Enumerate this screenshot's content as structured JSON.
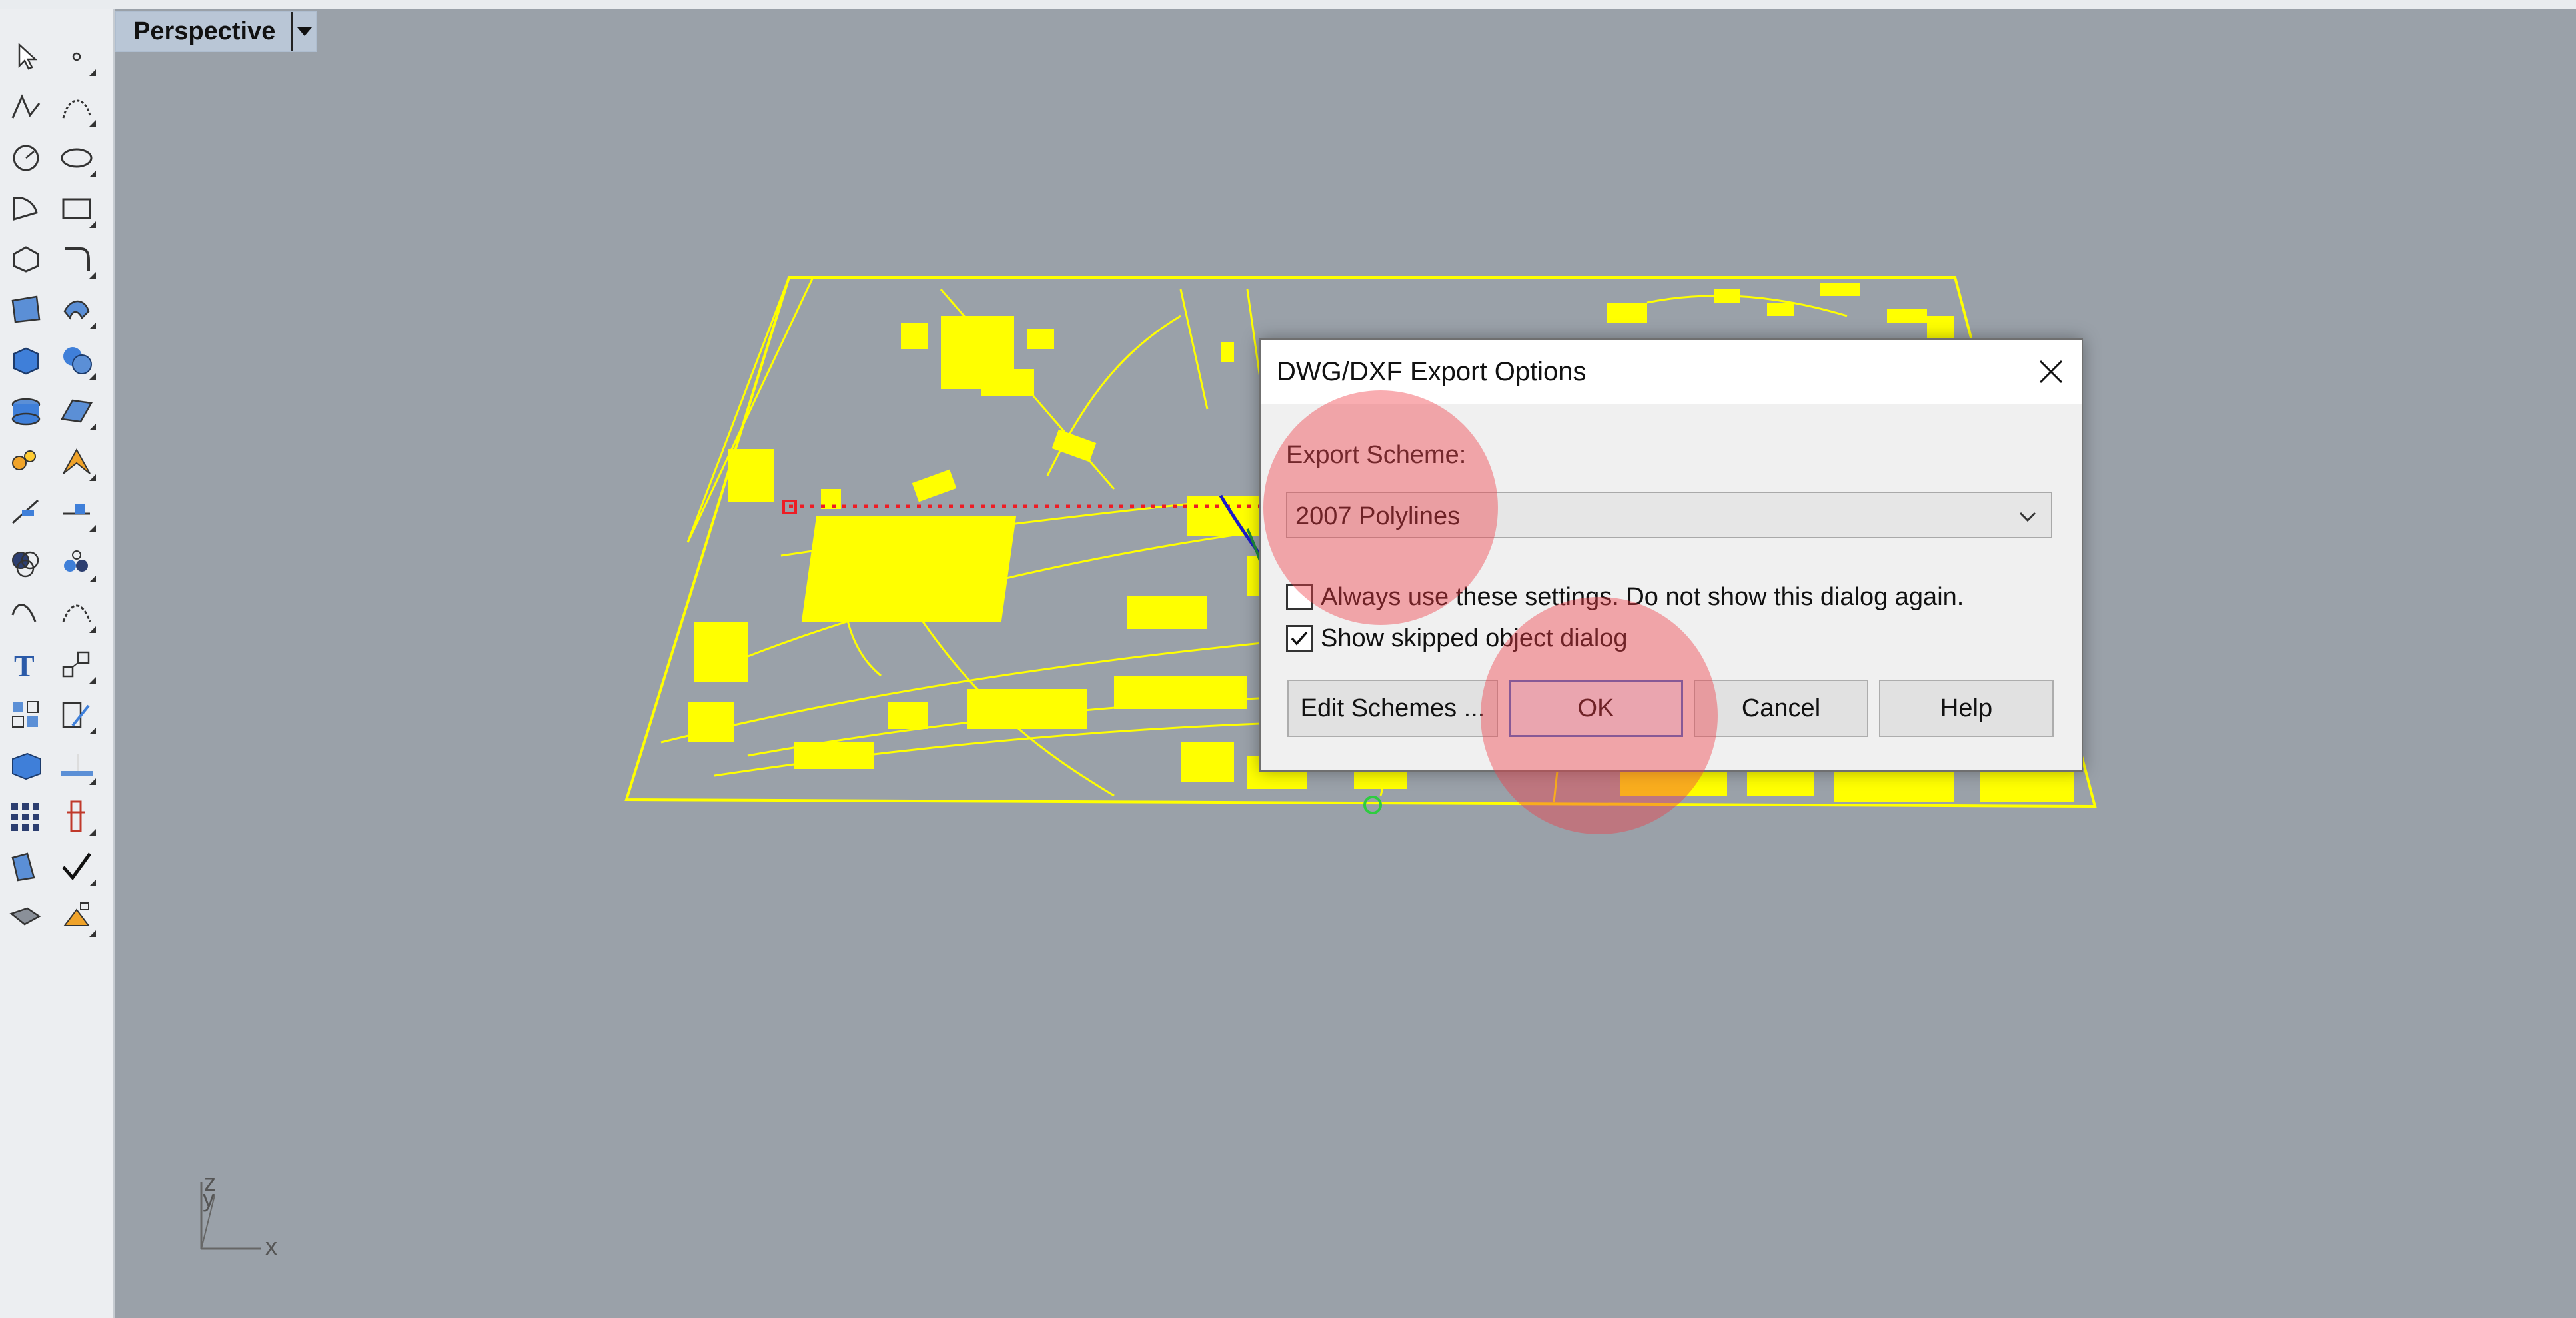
{
  "viewport": {
    "name": "Perspective"
  },
  "axis": {
    "x_label": "x",
    "y_label": "y",
    "z_label": "z"
  },
  "dialog": {
    "title": "DWG/DXF Export Options",
    "export_scheme_label": "Export Scheme:",
    "export_scheme_value": "2007 Polylines",
    "always_use_label": "Always use these settings. Do not show this dialog again.",
    "always_use_checked": false,
    "show_skipped_label": "Show skipped object dialog",
    "show_skipped_checked": true,
    "buttons": {
      "edit_schemes": "Edit Schemes ...",
      "ok": "OK",
      "cancel": "Cancel",
      "help": "Help"
    }
  },
  "toolbar": {
    "tools": [
      "select-arrow-icon",
      "point-icon",
      "polyline-icon",
      "curve-icon",
      "circle-icon",
      "ellipse-icon",
      "arc-icon",
      "rectangle-icon",
      "polygon-icon",
      "fillet-icon",
      "surface-icon",
      "loft-icon",
      "box-icon",
      "sphere-icon",
      "extrude-icon",
      "plane-surface-icon",
      "explode-icon",
      "split-icon",
      "trim-icon",
      "extend-icon",
      "boolean-icon",
      "group-icon",
      "curve-tool-icon",
      "blend-icon",
      "text-icon",
      "scale-icon",
      "array-icon",
      "dimension-icon",
      "block-icon",
      "layer-icon",
      "grid-icon",
      "analysis-icon",
      "render-icon",
      "check-icon",
      "material-icon",
      "paint-icon"
    ]
  },
  "colors": {
    "background": "#9aa1a9",
    "map": "#ffff00",
    "accent": "#3c6fd1",
    "highlight": "#f03c46"
  }
}
